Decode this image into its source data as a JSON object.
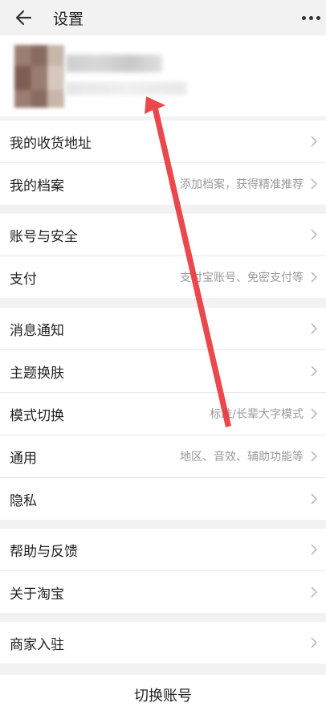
{
  "header": {
    "title": "设置",
    "back_icon": "arrow-left-icon",
    "more_icon": "more-dots-icon"
  },
  "groups": [
    {
      "items": [
        {
          "label": "我的收货地址",
          "value": ""
        },
        {
          "label": "我的档案",
          "value": "添加档案，获得精准推荐"
        }
      ]
    },
    {
      "items": [
        {
          "label": "账号与安全",
          "value": ""
        },
        {
          "label": "支付",
          "value": "支付宝账号、免密支付等"
        }
      ]
    },
    {
      "items": [
        {
          "label": "消息通知",
          "value": ""
        },
        {
          "label": "主题换肤",
          "value": ""
        },
        {
          "label": "模式切换",
          "value": "标准/长辈大字模式"
        },
        {
          "label": "通用",
          "value": "地区、音效、辅助功能等"
        },
        {
          "label": "隐私",
          "value": ""
        }
      ]
    },
    {
      "items": [
        {
          "label": "帮助与反馈",
          "value": ""
        },
        {
          "label": "关于淘宝",
          "value": ""
        }
      ]
    },
    {
      "items": [
        {
          "label": "商家入驻",
          "value": ""
        }
      ]
    }
  ],
  "footer": {
    "switch_account": "切换账号"
  },
  "colors": {
    "annotation_arrow": "#e8383d",
    "background": "#f2f2f2"
  }
}
